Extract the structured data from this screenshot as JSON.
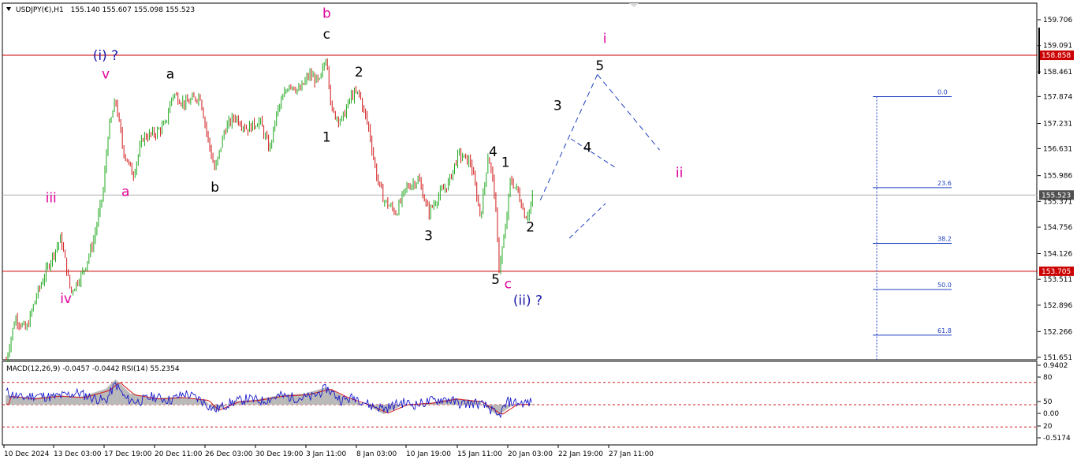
{
  "chart_data": {
    "type": "candlestick",
    "header": {
      "symbol": "USDJPY(€),H1",
      "ohlc": "155.140 155.607 155.098 155.523"
    },
    "indicator_header": "MACD(12,26,9) -0.0457 -0.0442  RSI(14) 55.2354",
    "price_ticks": [
      "159.706",
      "159.091",
      "158.461",
      "157.874",
      "157.231",
      "156.631",
      "155.986",
      "155.371",
      "154.756",
      "154.126",
      "153.511",
      "152.896",
      "152.266",
      "151.651"
    ],
    "price_tick_values": [
      159.706,
      159.091,
      158.461,
      157.874,
      157.231,
      156.631,
      155.986,
      155.371,
      154.756,
      154.126,
      153.511,
      152.896,
      152.266,
      151.651
    ],
    "price_range": [
      151.55,
      160.0
    ],
    "horizontal_levels": [
      {
        "label": "158.858",
        "value": 158.858,
        "color": "#cc0000"
      },
      {
        "label": "153.705",
        "value": 153.705,
        "color": "#cc0000"
      },
      {
        "label": "155.523",
        "value": 155.523,
        "color": "#b0b0b0"
      }
    ],
    "indicator_ticks": [
      "0.9402",
      "80",
      "50",
      "0.00",
      "20",
      "-0.5174"
    ],
    "indicator_tick_values": [
      0.9402,
      80,
      50,
      0.0,
      20,
      -0.5174
    ],
    "x_labels": [
      "10 Dec 2024",
      "13 Dec 03:00",
      "17 Dec 19:00",
      "20 Dec 11:00",
      "26 Dec 03:00",
      "30 Dec 19:00",
      "3 Jan 11:00",
      "8 Jan 03:00",
      "10 Jan 19:00",
      "15 Jan 11:00",
      "20 Jan 03:00",
      "22 Jan 19:00",
      "27 Jan 11:00"
    ],
    "fib_levels": [
      {
        "label": "0.0",
        "value": 157.87
      },
      {
        "label": "23.6",
        "value": 155.7
      },
      {
        "label": "38.2",
        "value": 154.37
      },
      {
        "label": "50.0",
        "value": 153.27
      },
      {
        "label": "61.8",
        "value": 152.18
      }
    ],
    "wave_labels": [
      {
        "text": "(i) ?",
        "x": 2,
        "y": 158.75,
        "color": "#1a1aa8"
      },
      {
        "text": "v",
        "x": 2,
        "y": 158.3,
        "color": "#e0009a"
      },
      {
        "text": "iii",
        "x": 0.9,
        "y": 155.35,
        "color": "#e0009a"
      },
      {
        "text": "iv",
        "x": 1.2,
        "y": 152.95,
        "color": "#e0009a"
      },
      {
        "text": "a",
        "x": 2.4,
        "y": 155.5,
        "color": "#e0009a"
      },
      {
        "text": "a",
        "x": 3.3,
        "y": 158.3,
        "color": "#000000"
      },
      {
        "text": "b",
        "x": 4.2,
        "y": 155.6,
        "color": "#000000"
      },
      {
        "text": "b",
        "x": 6.45,
        "y": 159.75,
        "color": "#e0009a"
      },
      {
        "text": "c",
        "x": 6.45,
        "y": 159.25,
        "color": "#000000"
      },
      {
        "text": "1",
        "x": 6.45,
        "y": 156.8,
        "color": "#000000"
      },
      {
        "text": "2",
        "x": 7.1,
        "y": 158.35,
        "color": "#000000"
      },
      {
        "text": "3",
        "x": 8.5,
        "y": 154.45,
        "color": "#000000"
      },
      {
        "text": "4",
        "x": 9.8,
        "y": 156.45,
        "color": "#000000"
      },
      {
        "text": "1",
        "x": 10.05,
        "y": 156.2,
        "color": "#000000"
      },
      {
        "text": "2",
        "x": 10.55,
        "y": 154.65,
        "color": "#000000"
      },
      {
        "text": "5",
        "x": 9.85,
        "y": 153.4,
        "color": "#000000"
      },
      {
        "text": "c",
        "x": 10.1,
        "y": 153.3,
        "color": "#e0009a"
      },
      {
        "text": "(ii) ?",
        "x": 10.5,
        "y": 152.9,
        "color": "#1a1aa8"
      },
      {
        "text": "i",
        "x": 12.05,
        "y": 159.15,
        "color": "#e0009a"
      },
      {
        "text": "5",
        "x": 11.95,
        "y": 158.5,
        "color": "#000000"
      },
      {
        "text": "3",
        "x": 11.1,
        "y": 157.55,
        "color": "#000000"
      },
      {
        "text": "4",
        "x": 11.7,
        "y": 156.55,
        "color": "#000000"
      },
      {
        "text": "ii",
        "x": 13.55,
        "y": 155.95,
        "color": "#e0009a"
      }
    ],
    "projection_path": [
      [
        10.75,
        155.4
      ],
      [
        11.9,
        158.4
      ],
      [
        13.15,
        156.6
      ]
    ],
    "price_points": [
      [
        0,
        151.6
      ],
      [
        0.18,
        152.6
      ],
      [
        0.4,
        152.3
      ],
      [
        0.6,
        153.1
      ],
      [
        0.9,
        154.0
      ],
      [
        1.1,
        154.5
      ],
      [
        1.3,
        153.2
      ],
      [
        1.55,
        153.7
      ],
      [
        1.75,
        154.4
      ],
      [
        1.95,
        155.6
      ],
      [
        2.05,
        157.0
      ],
      [
        2.2,
        157.8
      ],
      [
        2.35,
        156.6
      ],
      [
        2.55,
        156.0
      ],
      [
        2.75,
        156.9
      ],
      [
        3.0,
        157.0
      ],
      [
        3.2,
        157.2
      ],
      [
        3.35,
        157.95
      ],
      [
        3.6,
        157.7
      ],
      [
        3.9,
        157.9
      ],
      [
        4.05,
        156.9
      ],
      [
        4.2,
        156.1
      ],
      [
        4.4,
        157.1
      ],
      [
        4.6,
        157.4
      ],
      [
        4.85,
        157.1
      ],
      [
        5.1,
        157.3
      ],
      [
        5.3,
        156.6
      ],
      [
        5.45,
        157.5
      ],
      [
        5.7,
        158.2
      ],
      [
        5.9,
        158.0
      ],
      [
        6.1,
        158.4
      ],
      [
        6.3,
        158.2
      ],
      [
        6.45,
        158.85
      ],
      [
        6.55,
        157.5
      ],
      [
        6.75,
        157.3
      ],
      [
        6.95,
        157.9
      ],
      [
        7.1,
        157.95
      ],
      [
        7.3,
        157.1
      ],
      [
        7.45,
        156.0
      ],
      [
        7.6,
        155.4
      ],
      [
        7.85,
        155.1
      ],
      [
        8.05,
        155.7
      ],
      [
        8.3,
        155.9
      ],
      [
        8.5,
        155.1
      ],
      [
        8.7,
        155.5
      ],
      [
        8.9,
        155.8
      ],
      [
        9.1,
        156.5
      ],
      [
        9.35,
        156.3
      ],
      [
        9.55,
        155.0
      ],
      [
        9.7,
        156.5
      ],
      [
        9.82,
        155.7
      ],
      [
        9.92,
        153.8
      ],
      [
        10.05,
        154.7
      ],
      [
        10.15,
        155.9
      ],
      [
        10.3,
        155.6
      ],
      [
        10.45,
        155.0
      ],
      [
        10.55,
        155.2
      ],
      [
        10.6,
        155.5
      ]
    ],
    "indicator_line": [
      [
        0,
        67
      ],
      [
        0.3,
        59
      ],
      [
        0.6,
        63
      ],
      [
        0.9,
        60
      ],
      [
        1.2,
        63
      ],
      [
        1.45,
        66
      ],
      [
        1.7,
        60
      ],
      [
        2.0,
        55
      ],
      [
        2.2,
        78
      ],
      [
        2.4,
        58
      ],
      [
        2.65,
        54
      ],
      [
        2.95,
        61
      ],
      [
        3.3,
        56
      ],
      [
        3.6,
        65
      ],
      [
        3.9,
        57
      ],
      [
        4.2,
        43
      ],
      [
        4.5,
        52
      ],
      [
        4.85,
        58
      ],
      [
        5.15,
        55
      ],
      [
        5.5,
        62
      ],
      [
        5.85,
        59
      ],
      [
        6.15,
        60
      ],
      [
        6.45,
        72
      ],
      [
        6.75,
        56
      ],
      [
        7.05,
        60
      ],
      [
        7.35,
        48
      ],
      [
        7.65,
        45
      ],
      [
        7.95,
        53
      ],
      [
        8.25,
        50
      ],
      [
        8.55,
        55
      ],
      [
        8.85,
        58
      ],
      [
        9.15,
        51
      ],
      [
        9.45,
        52
      ],
      [
        9.7,
        47
      ],
      [
        9.9,
        33
      ],
      [
        10.1,
        54
      ],
      [
        10.35,
        52
      ],
      [
        10.6,
        53
      ]
    ],
    "macd_series": [
      [
        0,
        0.3
      ],
      [
        0.5,
        0.2
      ],
      [
        1.0,
        0.3
      ],
      [
        1.5,
        0.25
      ],
      [
        2.0,
        0.5
      ],
      [
        2.2,
        0.8
      ],
      [
        2.5,
        0.35
      ],
      [
        3.0,
        0.2
      ],
      [
        3.5,
        0.25
      ],
      [
        4.0,
        0.15
      ],
      [
        4.2,
        -0.2
      ],
      [
        4.6,
        0.1
      ],
      [
        5.0,
        0.15
      ],
      [
        5.5,
        0.3
      ],
      [
        6.0,
        0.35
      ],
      [
        6.45,
        0.55
      ],
      [
        6.8,
        0.25
      ],
      [
        7.3,
        -0.05
      ],
      [
        7.6,
        -0.3
      ],
      [
        8.0,
        0.0
      ],
      [
        8.5,
        0.05
      ],
      [
        9.0,
        0.2
      ],
      [
        9.5,
        0.1
      ],
      [
        9.9,
        -0.35
      ],
      [
        10.2,
        0.0
      ],
      [
        10.6,
        0.02
      ]
    ]
  }
}
